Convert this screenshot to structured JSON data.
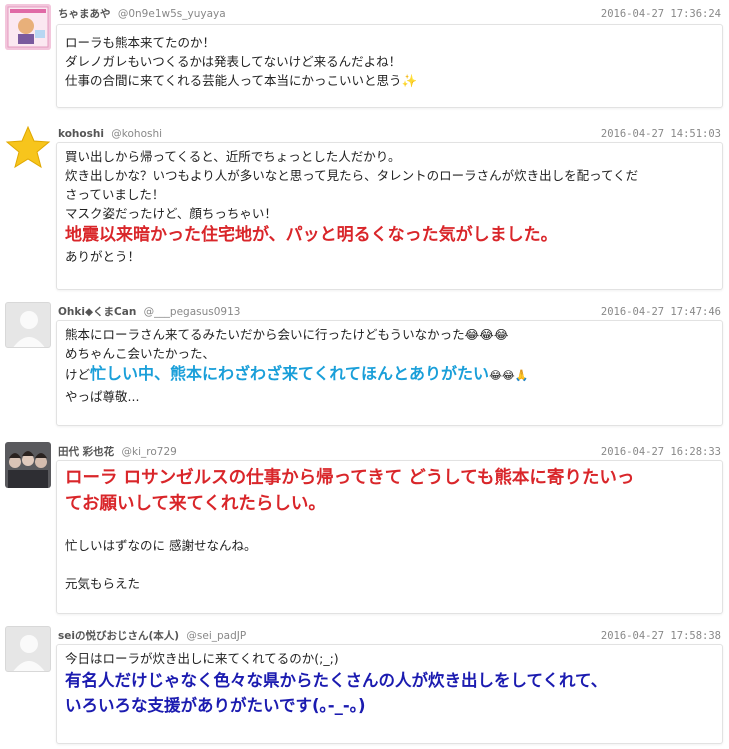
{
  "tweets": [
    {
      "name": "ちゃまあや",
      "handle": "@0n9e1w5s_yuyaya",
      "time": "2016-04-27 17:36:24",
      "avatar": "pink-profile-photo",
      "lines": [
        "ローラも熊本来てたのか！",
        "ダレノガレもいつくるかは発表してないけど来るんだよね！",
        "仕事の合間に来てくれる芸能人って本当にかっこいいと思う"
      ],
      "end_emoji": "✨"
    },
    {
      "name": "kohoshi",
      "handle": "@kohoshi",
      "time": "2016-04-27 14:51:03",
      "avatar": "star-icon",
      "lines": [
        "買い出しから帰ってくると、近所でちょっとした人だかり。",
        "炊き出しかな？いつもより人が多いなと思って見たら、タレントのローラさんが炊き出しを配ってくだ",
        "さっていました！",
        "マスク姿だったけど、顔ちっちゃい！"
      ],
      "highlight": "地震以来暗かった住宅地が、パッと明るくなった気がしました。",
      "after": "ありがとう！"
    },
    {
      "name": "Ohki◆くまCan",
      "handle": "@___pegasus0913",
      "time": "2016-04-27 17:47:46",
      "avatar": "default-avatar",
      "lines": [
        "熊本にローラさん来てるみたいだから会いに行ったけどもういなかった😂😂😂",
        "めちゃんこ会いたかった、"
      ],
      "mixed_prefix": "けど",
      "highlight": "忙しい中、熊本にわざわざ来てくれてほんとありがたい",
      "highlight_emoji": "😂😂🙏",
      "after": "やっぱ尊敬..."
    },
    {
      "name": "田代 彩也花",
      "handle": "@ki_ro729",
      "time": "2016-04-27 16:28:33",
      "avatar": "group-photo",
      "highlight_lines": [
        "ローラ ロサンゼルスの仕事から帰ってきて どうしても熊本に寄りたいっ",
        "てお願いして来てくれたらしい。"
      ],
      "lines_after": [
        "忙しいはずなのに 感謝せなんね。",
        "元気もらえた"
      ]
    },
    {
      "name": "seiの悦びおじさん(本人)",
      "handle": "@sei_padJP",
      "time": "2016-04-27 17:58:38",
      "avatar": "default-avatar",
      "lines": [
        "今日はローラが炊き出しに来てくれてるのか(;_;)"
      ],
      "highlight_lines": [
        "有名人だけじゃなく色々な県からたくさんの人が炊き出しをしてくれて、",
        "いろいろな支援がありがたいです(｡-_-｡)"
      ]
    }
  ],
  "colors": {
    "red": "#d9262a",
    "blue": "#1a9fd9",
    "navy": "#1b1bb0",
    "meta": "#888888"
  }
}
